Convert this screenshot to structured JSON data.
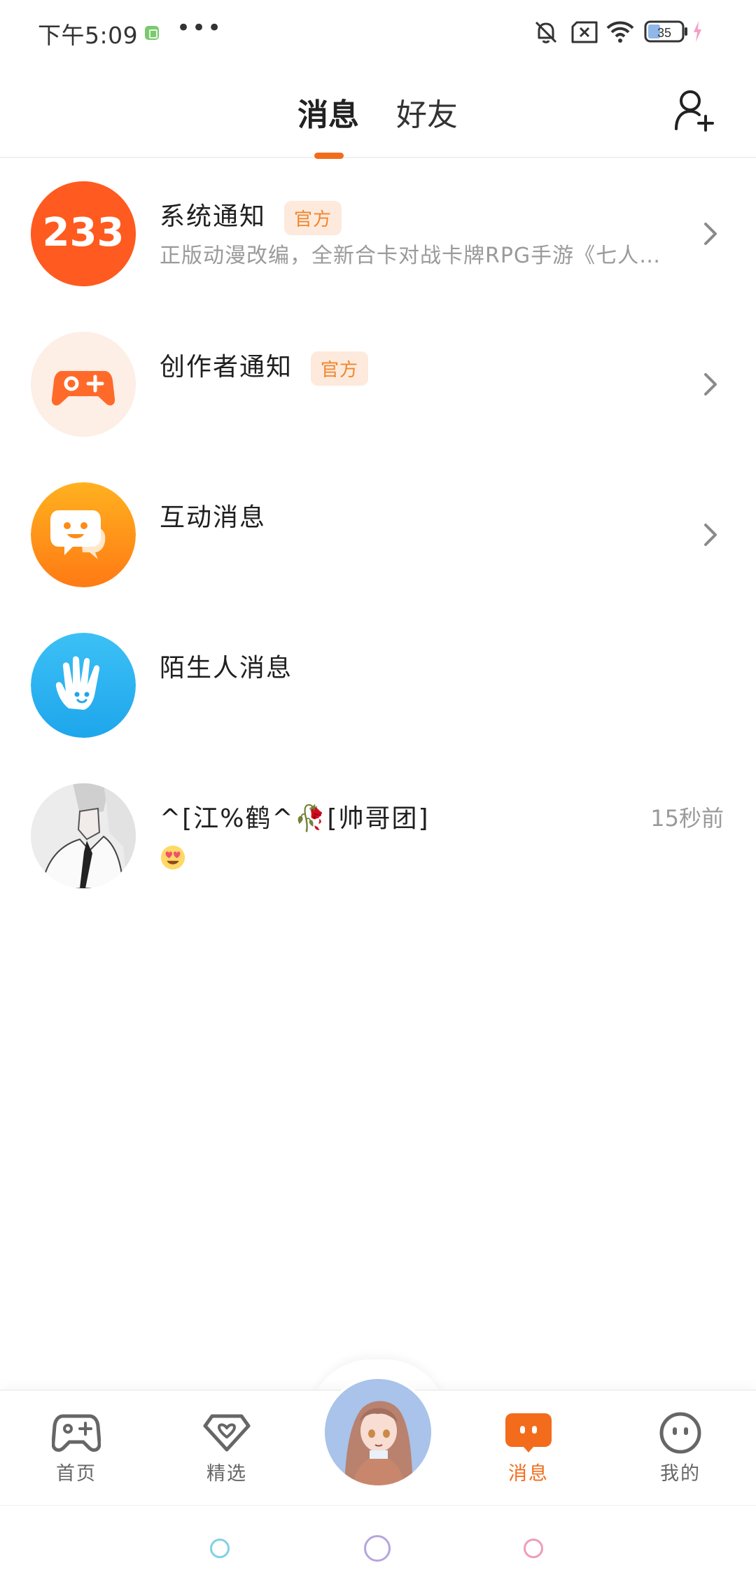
{
  "status_bar": {
    "time": "下午5:09",
    "dots": "•••",
    "battery_level": "35",
    "icons": [
      "app-notification-icon",
      "mute-bell-icon",
      "sim-error-icon",
      "wifi-icon",
      "battery-icon",
      "charging-icon"
    ]
  },
  "header": {
    "tabs": [
      {
        "label": "消息",
        "active": true
      },
      {
        "label": "好友",
        "active": false
      }
    ],
    "accent_color": "#f26c1b",
    "add_friend_icon": "add-friend-icon"
  },
  "messages": [
    {
      "title": "系统通知",
      "badge": "官方",
      "subtitle": "正版动漫改编，全新合卡对战卡牌RPG手游《七人…",
      "avatar_text": "233",
      "avatar_color": "#ff5a1f",
      "has_chevron": true
    },
    {
      "title": "创作者通知",
      "badge": "官方",
      "subtitle": "",
      "avatar_icon": "gamepad-icon",
      "avatar_color": "#fdeee6",
      "has_chevron": true
    },
    {
      "title": "互动消息",
      "subtitle": "",
      "avatar_icon": "chat-bubbles-icon",
      "avatar_color": "#ff9a1a",
      "has_chevron": true
    },
    {
      "title": "陌生人消息",
      "subtitle": "",
      "avatar_icon": "waving-hand-icon",
      "avatar_color": "#2eb4f0",
      "has_chevron": false
    },
    {
      "title": "^[江%鹤^🥀[帅哥团]",
      "time": "15秒前",
      "preview_emoji": "heart-eyes-emoji",
      "avatar_icon": "user-avatar-image",
      "has_chevron": false
    }
  ],
  "bottom_nav": {
    "items": [
      {
        "label": "首页",
        "icon": "gamepad-icon",
        "active": false
      },
      {
        "label": "精选",
        "icon": "heart-gem-icon",
        "active": false
      },
      {
        "label": "",
        "icon": "center-avatar",
        "active": false
      },
      {
        "label": "消息",
        "icon": "message-icon",
        "active": true
      },
      {
        "label": "我的",
        "icon": "smiley-icon",
        "active": false
      }
    ]
  },
  "system_nav": {
    "buttons": [
      "back-button",
      "home-button",
      "recents-button"
    ],
    "colors": [
      "#7fd0e8",
      "#b5a4e0",
      "#f09cba"
    ]
  }
}
